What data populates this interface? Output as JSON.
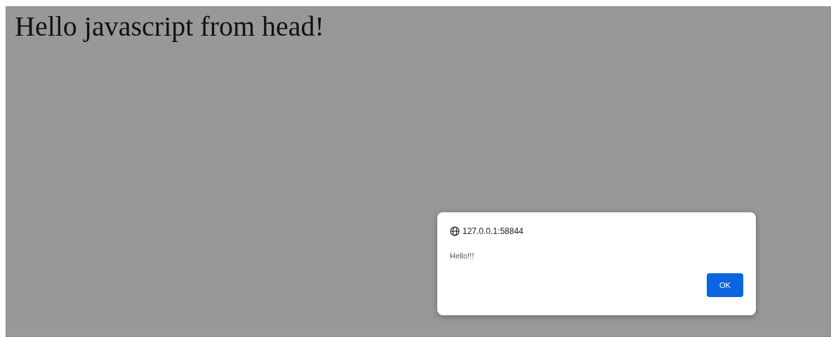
{
  "page": {
    "heading": "Hello javascript from head!"
  },
  "dialog": {
    "origin": "127.0.0.1:58844",
    "message": "Hello!!!",
    "buttons": [
      "OK"
    ]
  }
}
